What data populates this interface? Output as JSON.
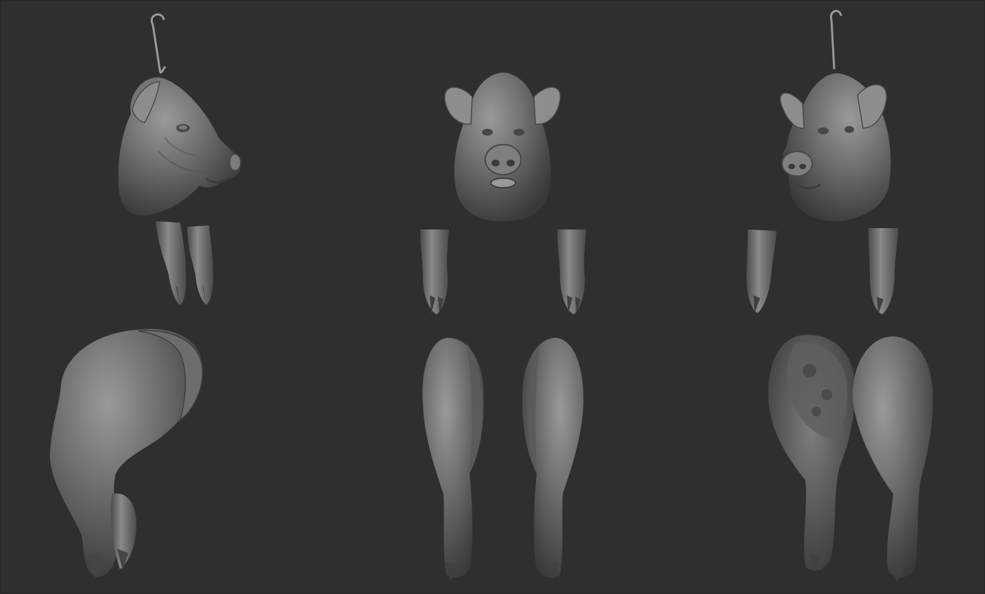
{
  "viewport": {
    "background": "#2f2f2f",
    "material_light": "#8a8a8a",
    "material_mid": "#6a6a6a",
    "material_dark": "#3e3e3e"
  },
  "views": [
    {
      "label": "",
      "orientation": "side"
    },
    {
      "label": "",
      "orientation": "front"
    },
    {
      "label": "",
      "orientation": "three-quarter"
    }
  ],
  "parts": [
    "hook",
    "pig-head",
    "front-trotter",
    "hind-leg-ham"
  ]
}
